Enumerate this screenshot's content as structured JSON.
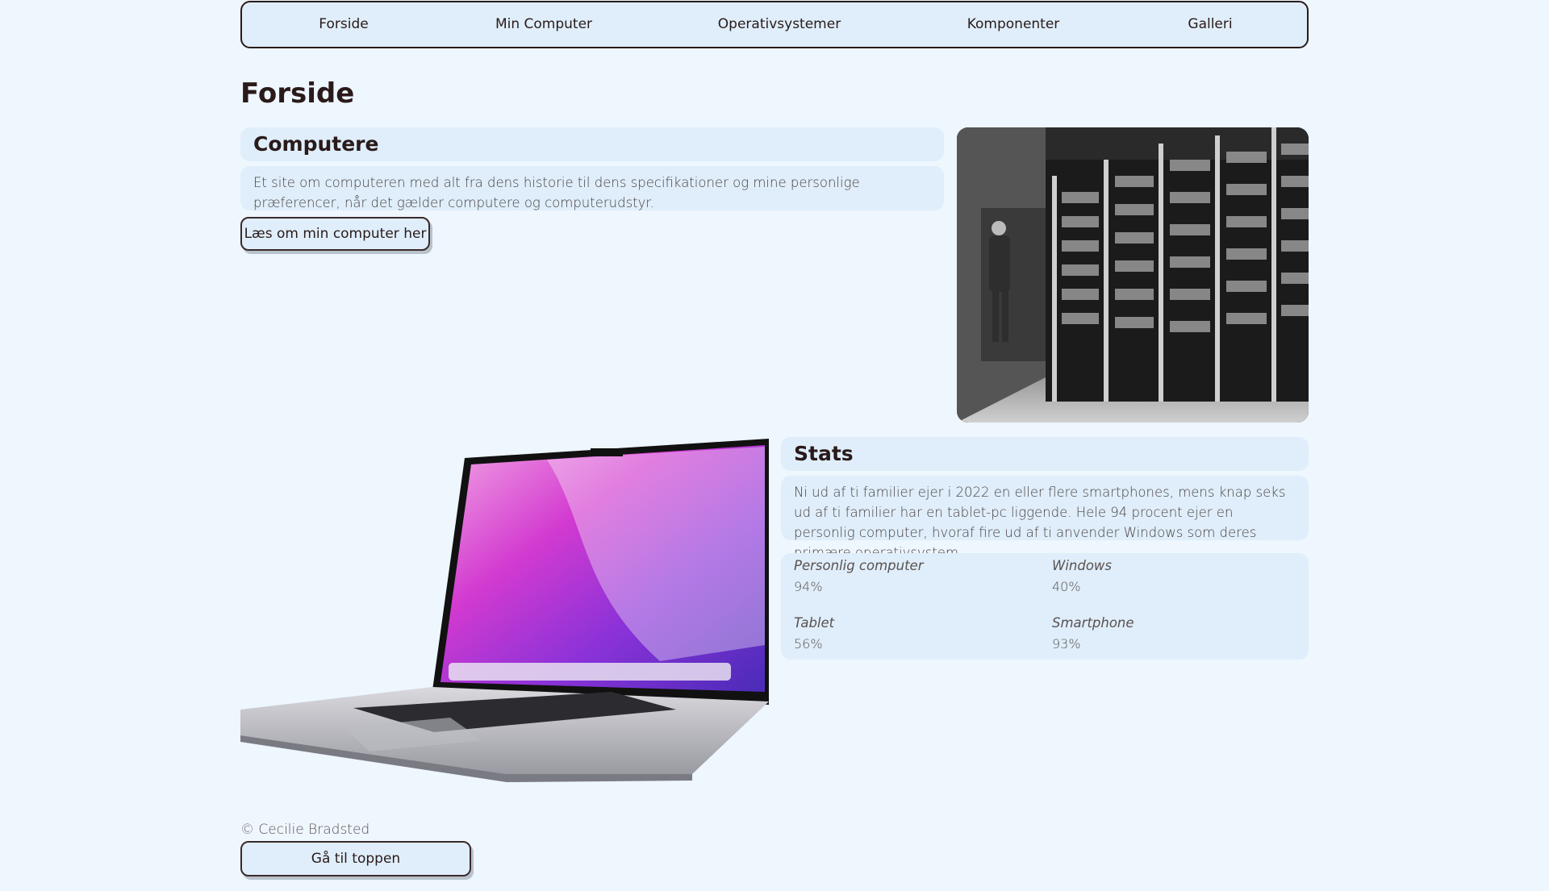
{
  "nav": {
    "items": [
      "Forside",
      "Min Computer",
      "Operativsystemer",
      "Komponenter",
      "Galleri"
    ]
  },
  "page": {
    "title": "Forside"
  },
  "computers": {
    "heading": "Computere",
    "text": "Et site om computeren med alt fra dens historie til dens specifikationer og mine personlige præferencer, når det gælder computere og computerudstyr.",
    "button_label": "Læs om min computer her"
  },
  "stats": {
    "heading": "Stats",
    "text": "Ni ud af ti familier ejer i 2022 en eller flere smartphones, mens knap seks ud af ti familier har en tablet-pc liggende. Hele 94 procent ejer en personlig computer, hvoraf fire ud af ti anvender Windows som deres primære operativsystem.",
    "items": [
      {
        "label": "Personlig computer",
        "value": "94%"
      },
      {
        "label": "Windows",
        "value": "40%"
      },
      {
        "label": "Tablet",
        "value": "56%"
      },
      {
        "label": "Smartphone",
        "value": "93%"
      }
    ]
  },
  "footer": {
    "copyright": "© Cecilie Bradsted",
    "top_button_label": "Gå til toppen"
  }
}
